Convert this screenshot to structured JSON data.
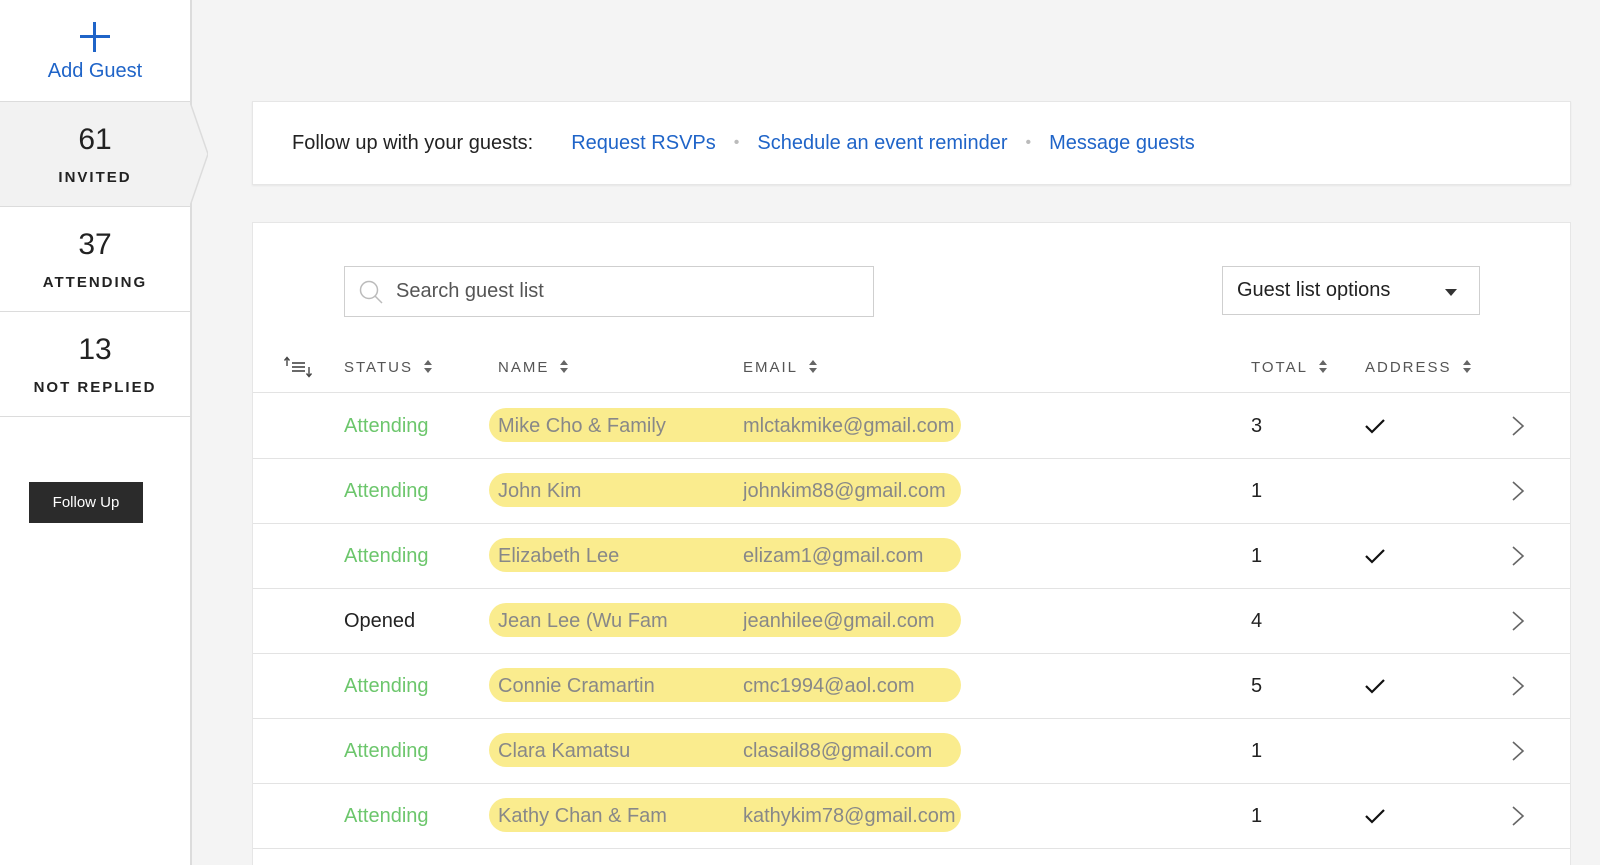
{
  "sidebar": {
    "add_guest_label": "Add Guest",
    "stats": [
      {
        "count": "61",
        "label": "INVITED"
      },
      {
        "count": "37",
        "label": "ATTENDING"
      },
      {
        "count": "13",
        "label": "NOT REPLIED"
      }
    ],
    "follow_up_label": "Follow Up"
  },
  "banner": {
    "prompt": "Follow up with your guests:",
    "links": [
      "Request RSVPs",
      "Schedule an event reminder",
      "Message guests"
    ],
    "separator": "•"
  },
  "guest_list": {
    "search_placeholder": "Search guest list",
    "options_label": "Guest list options",
    "columns": {
      "status": "STATUS",
      "name": "NAME",
      "email": "EMAIL",
      "total": "TOTAL",
      "address": "ADDRESS"
    },
    "rows": [
      {
        "status": "Attending",
        "name": "Mike Cho & Family",
        "email": "mlctakmike@gmail.com",
        "total": "3",
        "address": "✓"
      },
      {
        "status": "Attending",
        "name": "John Kim",
        "email": "johnkim88@gmail.com",
        "total": "1",
        "address": ""
      },
      {
        "status": "Attending",
        "name": "Elizabeth Lee",
        "email": "elizam1@gmail.com",
        "total": "1",
        "address": "✓"
      },
      {
        "status": "Opened",
        "name": "Jean Lee (Wu Fam",
        "email": "jeanhilee@gmail.com",
        "total": "4",
        "address": ""
      },
      {
        "status": "Attending",
        "name": "Connie Cramartin",
        "email": "cmc1994@aol.com",
        "total": "5",
        "address": "✓"
      },
      {
        "status": "Attending",
        "name": "Clara Kamatsu",
        "email": "clasail88@gmail.com",
        "total": "1",
        "address": ""
      },
      {
        "status": "Attending",
        "name": "Kathy Chan & Fam",
        "email": "kathykim78@gmail.com",
        "total": "1",
        "address": "✓"
      }
    ]
  },
  "colors": {
    "accent": "#1f64c8",
    "attending": "#6cc66c",
    "highlight": "#f9ea82"
  },
  "icons": {
    "add": "plus-icon",
    "search": "search-icon",
    "dropdown": "caret-down-icon",
    "sort": "sort-list-icon",
    "row_open": "chevron-right-icon",
    "address_present": "checkmark-icon"
  }
}
